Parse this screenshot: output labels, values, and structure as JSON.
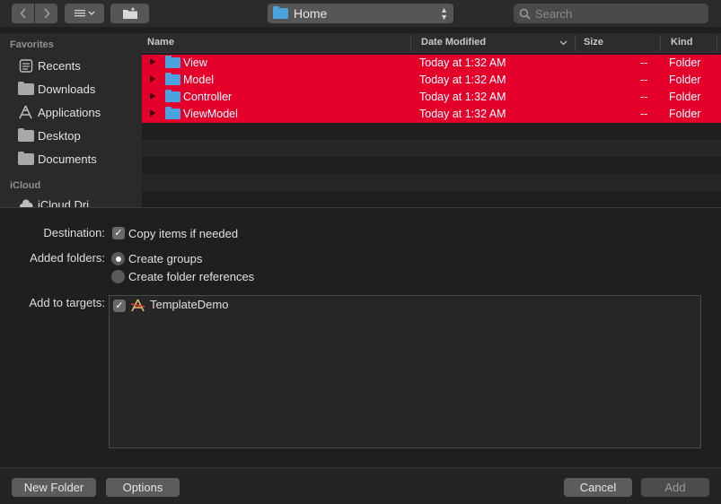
{
  "toolbar": {
    "location": "Home",
    "search_placeholder": "Search"
  },
  "sidebar": {
    "favorites_header": "Favorites",
    "items": [
      {
        "label": "Recents",
        "icon": "recents-icon"
      },
      {
        "label": "Downloads",
        "icon": "folder-icon"
      },
      {
        "label": "Applications",
        "icon": "applications-icon"
      },
      {
        "label": "Desktop",
        "icon": "folder-icon"
      },
      {
        "label": "Documents",
        "icon": "folder-icon"
      }
    ],
    "icloud_header": "iCloud",
    "icloud_item": "iCloud Dri..."
  },
  "columns": {
    "name": "Name",
    "date": "Date Modified",
    "size": "Size",
    "kind": "Kind"
  },
  "rows": [
    {
      "name": "View",
      "date": "Today at 1:32 AM",
      "size": "--",
      "kind": "Folder"
    },
    {
      "name": "Model",
      "date": "Today at 1:32 AM",
      "size": "--",
      "kind": "Folder"
    },
    {
      "name": "Controller",
      "date": "Today at 1:32 AM",
      "size": "--",
      "kind": "Folder"
    },
    {
      "name": "ViewModel",
      "date": "Today at 1:32 AM",
      "size": "--",
      "kind": "Folder"
    }
  ],
  "options": {
    "destination_label": "Destination:",
    "copy_items": "Copy items if needed",
    "added_folders_label": "Added folders:",
    "create_groups": "Create groups",
    "create_folder_refs": "Create folder references",
    "add_targets_label": "Add to targets:",
    "target_name": "TemplateDemo"
  },
  "buttons": {
    "new_folder": "New Folder",
    "options": "Options",
    "cancel": "Cancel",
    "add": "Add"
  },
  "colors": {
    "selection": "#e4002b",
    "folder_blue": "#4aa3df",
    "background": "#1f1f1f"
  }
}
